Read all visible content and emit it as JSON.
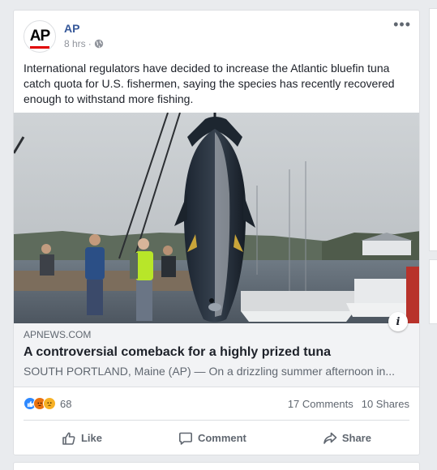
{
  "post": {
    "author": "AP",
    "avatar_text": "AP",
    "time": "8 hrs",
    "separator": "·",
    "privacy_icon": "globe-icon",
    "more_label": "•••",
    "text": "International regulators have decided to increase the Atlantic bluefin tuna catch quota for U.S. fishermen, saying the species has recently recovered enough to withstand more fishing."
  },
  "link": {
    "domain": "APNEWS.COM",
    "title": "A controversial comeback for a highly prized tuna",
    "description": "SOUTH PORTLAND, Maine (AP) — On a drizzling summer afternoon in...",
    "info_label": "i"
  },
  "stats": {
    "reaction_count": "68",
    "comments": "17 Comments",
    "shares": "10 Shares",
    "reaction_icons": [
      "like-icon",
      "angry-icon",
      "sad-icon"
    ]
  },
  "actions": {
    "like": "Like",
    "comment": "Comment",
    "share": "Share"
  },
  "colors": {
    "link_blue": "#365899",
    "like_blue": "#2d88ff",
    "angry_orange": "#e9710f",
    "sad_yellow": "#f7b125"
  }
}
